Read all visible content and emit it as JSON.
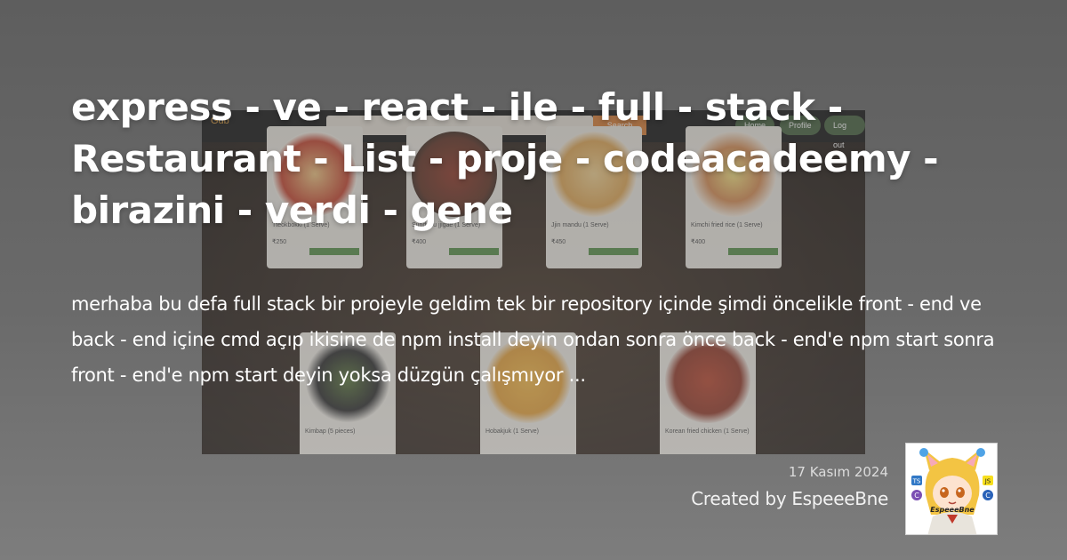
{
  "title": "express - ve - react - ile - full - stack - Restaurant - List - proje - codeacadeemy - birazini - verdi - gene",
  "description": "merhaba bu defa full stack bir projeyle geldim tek bir repository içinde şimdi öncelikle front - end ve back - end içine cmd açıp ikisine de npm install deyin ondan sonra önce back - end'e npm start sonra front - end'e npm start deyin yoksa düzgün çalışmıyor ...",
  "date": "17 Kasım 2024",
  "created_by": "Created by EspeeeBne",
  "avatar": {
    "name_label": "EspeeeBne",
    "badges": [
      "TS",
      "JS",
      "C"
    ]
  },
  "background_screenshot": {
    "logo": "Gdb",
    "search_button": "Search",
    "nav": [
      "Home",
      "Profile",
      "Log out"
    ],
    "cards": [
      {
        "name": "Tteokbokki (1 Serve)",
        "price": "₹250"
      },
      {
        "name": "Sundubu jjigae (1 Serve)",
        "price": "₹400"
      },
      {
        "name": "Jjin mandu (1 Serve)",
        "price": "₹450"
      },
      {
        "name": "Kimchi fried rice (1 Serve)",
        "price": "₹400"
      },
      {
        "name": "Kimbap (5 pieces)",
        "price": ""
      },
      {
        "name": "Hobakjuk (1 Serve)",
        "price": ""
      },
      {
        "name": "Korean fried chicken (1 Serve)",
        "price": ""
      }
    ]
  },
  "colors": {
    "background": "#666666",
    "text": "#ffffff",
    "accent_orange": "#d9772c",
    "nav_green": "#3d5a36"
  }
}
